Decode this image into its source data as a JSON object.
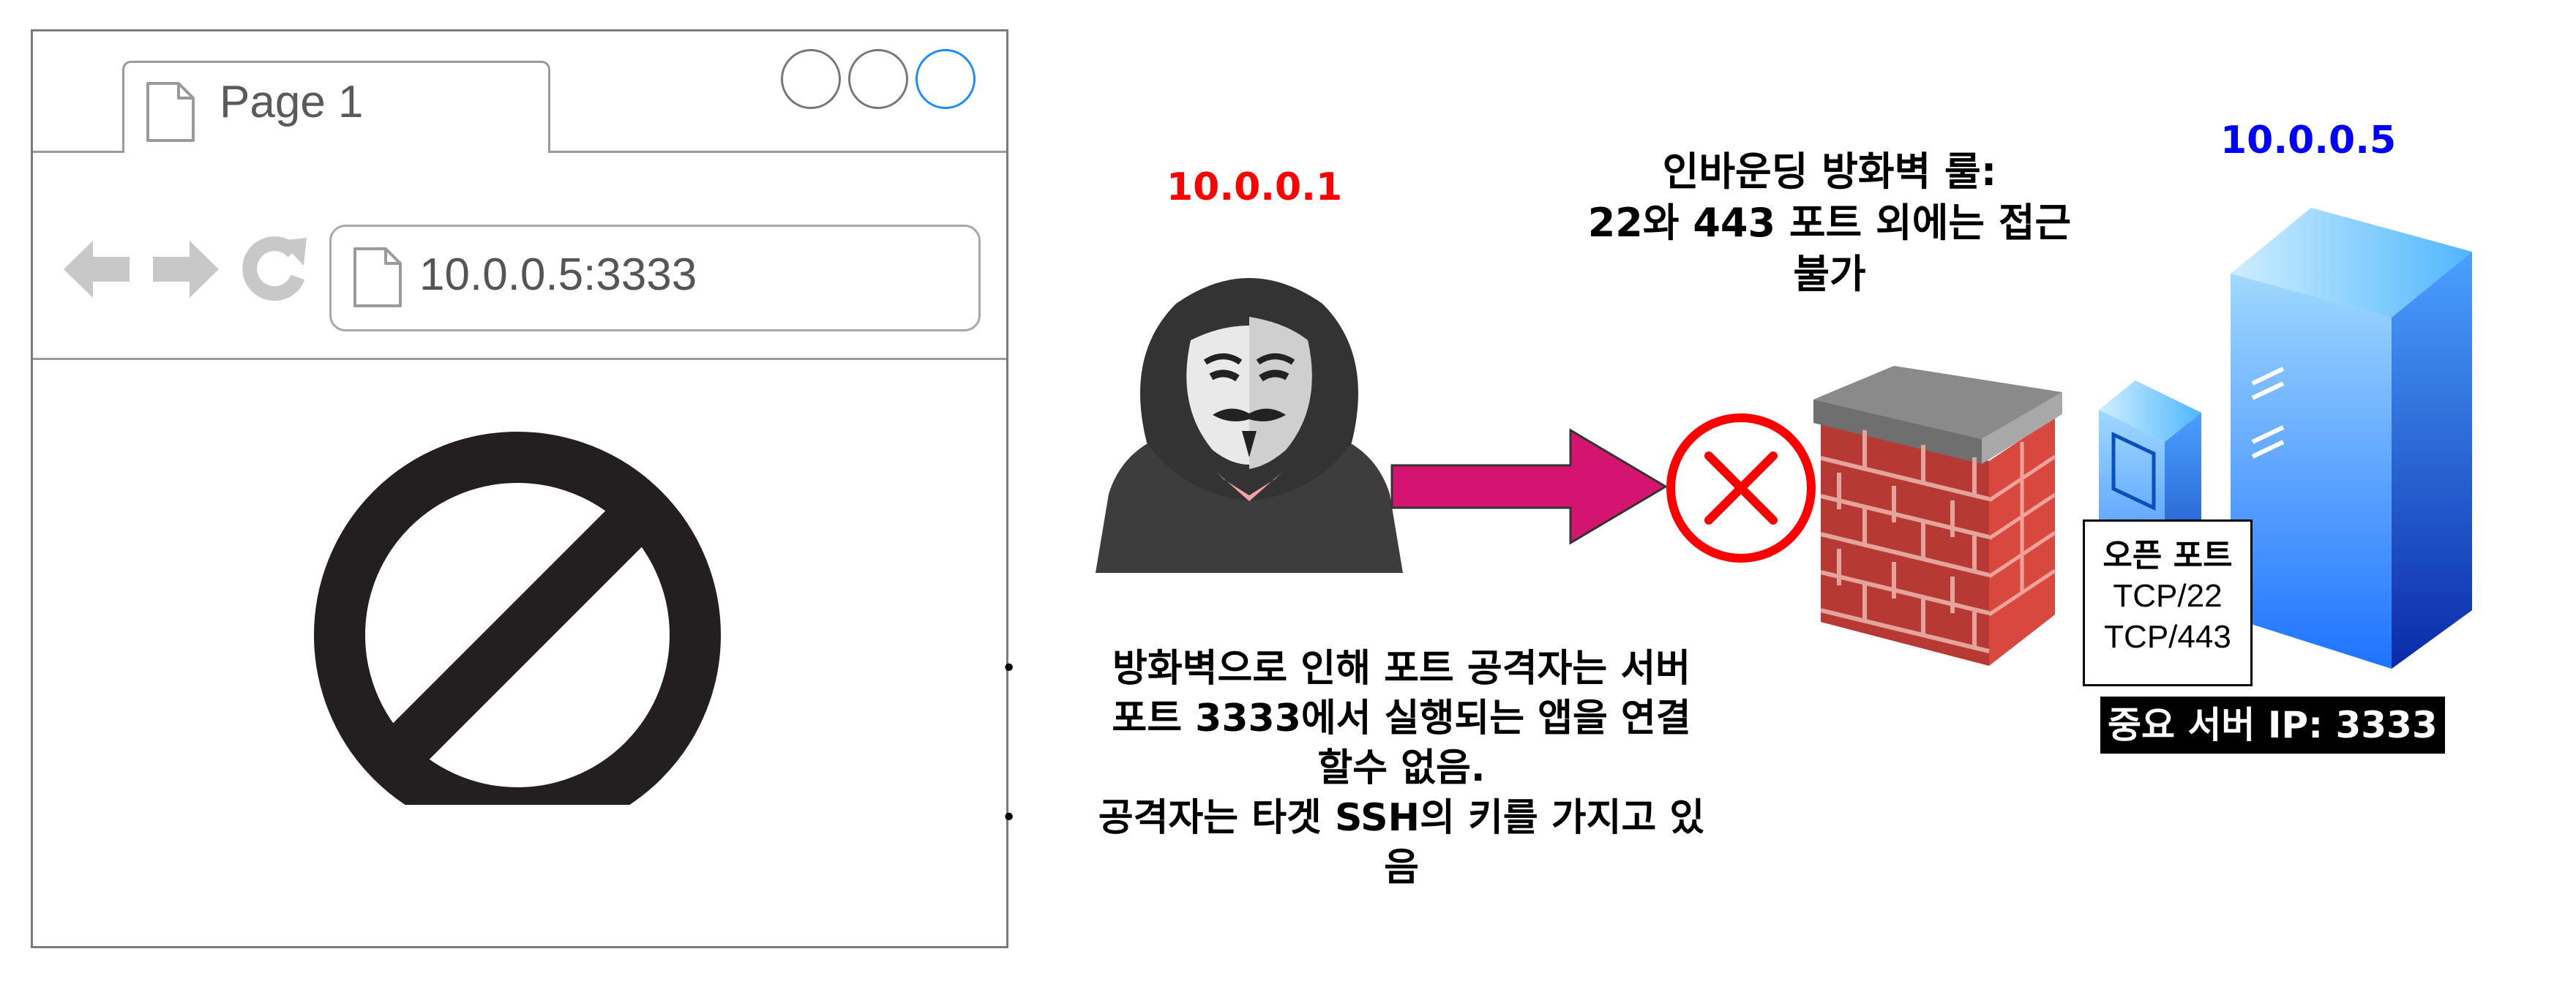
{
  "browser": {
    "tab_title": "Page 1",
    "address": "10.0.0.5:3333",
    "window_buttons": [
      "minimize",
      "maximize",
      "close"
    ],
    "nav_icons": [
      "back-arrow-icon",
      "forward-arrow-icon",
      "reload-icon"
    ],
    "content_icon": "blocked-icon",
    "accent_color": "#1a8cff"
  },
  "attacker": {
    "ip": "10.0.0.1",
    "ip_color": "#ff0000",
    "icon": "hacker-icon"
  },
  "arrow": {
    "color": "#d4146e"
  },
  "blocked_marker": {
    "icon": "block-x-icon",
    "color": "#ff0000"
  },
  "firewall": {
    "icon": "firewall-icon",
    "rule_lines": [
      "인바운딩 방화벽 룰:",
      "22와 443 포트 외에는 접근",
      "불가"
    ]
  },
  "server": {
    "ip": "10.0.0.5",
    "ip_color": "#0000ff",
    "icon": "server-icon",
    "open_ports_title": "오픈 포트",
    "open_ports": [
      "TCP/22",
      "TCP/443"
    ],
    "label": "중요 서버 IP: 3333"
  },
  "notes": [
    {
      "lines": [
        "방화벽으로 인해 포트 공격자는 서버",
        "포트 3333에서 실행되는 앱을 연결",
        "할수 없음."
      ]
    },
    {
      "lines": [
        "공격자는 타겟 SSH의 키를 가지고 있",
        "음"
      ]
    }
  ]
}
